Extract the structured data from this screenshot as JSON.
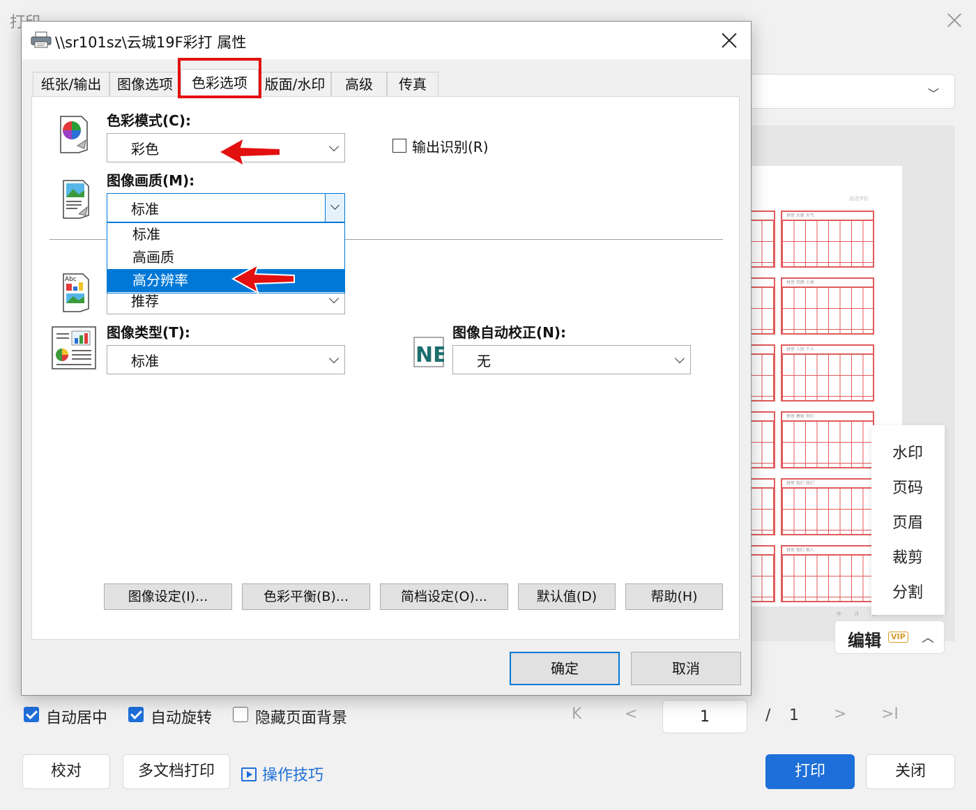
{
  "background": {
    "window_title": "打印",
    "side_menu": [
      "水印",
      "页码",
      "页眉",
      "裁剪",
      "分割"
    ],
    "edit_button": {
      "label": "编辑",
      "badge": "VIP"
    },
    "paper": {
      "header_note": "自选字帖",
      "footer": "年 月 日"
    },
    "preview_captions": [
      "拼音 大家 大气",
      "拼音 风雨 土地",
      "拼音 人民 个人",
      "拼音 春秋 你们",
      "拼音 我们 我们",
      "拼音 他们 他人"
    ],
    "options": [
      {
        "label": "自动居中",
        "checked": true
      },
      {
        "label": "自动旋转",
        "checked": true
      },
      {
        "label": "隐藏页面背景",
        "checked": false
      }
    ],
    "pager": {
      "first": "K",
      "prev": "<",
      "current_page": "1",
      "separator": "/",
      "total": "1",
      "next": ">",
      "last": ">I"
    },
    "buttons": {
      "proof": "校对",
      "multi_doc": "多文档打印",
      "tips": "操作技巧",
      "print": "打印",
      "close": "关闭"
    }
  },
  "dialog": {
    "title": "\\\\sr101sz\\云城19F彩打 属性",
    "tabs": [
      "纸张/输出",
      "图像选项",
      "色彩选项",
      "版面/水印",
      "高级",
      "传真"
    ],
    "active_tab": "色彩选项",
    "color_mode": {
      "label": "色彩模式(C):",
      "value": "彩色"
    },
    "output_id": {
      "label": "输出识别(R)",
      "checked": false
    },
    "image_quality": {
      "label": "图像画质(M):",
      "value": "标准",
      "options": [
        "标准",
        "高画质",
        "高分辨率"
      ],
      "highlighted": "高分辨率"
    },
    "hidden_combo_value": "推荐",
    "image_type": {
      "label": "图像类型(T):",
      "value": "标准"
    },
    "auto_correct": {
      "label": "图像自动校正(N):",
      "value": "无"
    },
    "panel_buttons": [
      "图像设定(I)...",
      "色彩平衡(B)...",
      "简档设定(O)...",
      "默认值(D)",
      "帮助(H)"
    ],
    "ok": "确定",
    "cancel": "取消",
    "icon_texts": {
      "abc": "Abc",
      "ne": "NE"
    }
  },
  "colors": {
    "accent": "#1e6fd9",
    "highlight_red": "#e31010",
    "selection": "#0078d7",
    "grid_red": "#e05a5a"
  }
}
